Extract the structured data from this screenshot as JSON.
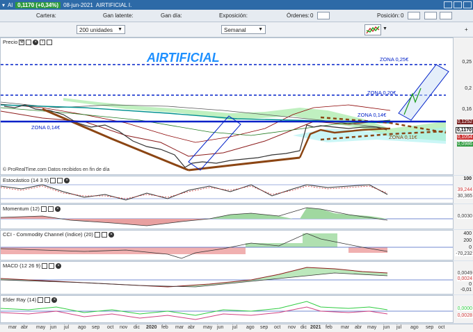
{
  "titlebar": {
    "market": "Al",
    "price": "0,1170 (+0,34%)",
    "date": "08-jun-2021",
    "name": "AIRTIFICIAL I."
  },
  "infobar": {
    "cartera": "Cartera:",
    "ganancia_latente": "Gan latente:",
    "ganancia_dia": "Gan día:",
    "exposicion": "Exposición:",
    "ordenes": "Órdenes:",
    "ordenes_val": "0",
    "posicion": "Posición:",
    "posicion_val": "0"
  },
  "toolbar": {
    "units": "200 unidades",
    "period": "Semanal"
  },
  "price_panel": {
    "title": "Precio",
    "footer": "© ProRealTime.com Datos recibidos en fin de día",
    "watermark": "AIRTIFICIAL",
    "annotations": [
      "ZONA 0,25€",
      "ZONA 0,20€",
      "ZONA 0,14€",
      "ZONA 0,14€",
      "ZONA 0,11€"
    ],
    "yticks": [
      "0,25",
      "0,2",
      "0,16"
    ],
    "boxes": [
      "0,1252",
      "0,1170",
      "0,1054",
      "0,0986"
    ]
  },
  "panels": [
    {
      "title": "Estocástico (14 3 5)",
      "ticks": [
        "100"
      ],
      "boxes": [
        "39,244",
        "30,365"
      ]
    },
    {
      "title": "Momentum (12)",
      "ticks": [],
      "boxes": [
        "0,0030"
      ]
    },
    {
      "title": "CCI - Commodity Channel (índice) (20)",
      "ticks": [
        "400",
        "200",
        "0"
      ],
      "boxes": [
        "-70,232"
      ]
    },
    {
      "title": "MACD (12 26 9)",
      "ticks": [
        "0",
        "-0,01"
      ],
      "boxes": [
        "0,0049",
        "0,0024"
      ]
    },
    {
      "title": "Elder Ray (14)",
      "ticks": [],
      "boxes": [
        "0,0000",
        "0,0028"
      ]
    }
  ],
  "xaxis": [
    "mar",
    "abr",
    "may",
    "jun",
    "jul",
    "ago",
    "sep",
    "oct",
    "nov",
    "dic",
    "2020",
    "feb",
    "mar",
    "abr",
    "may",
    "jun",
    "jul",
    "ago",
    "sep",
    "oct",
    "nov",
    "dic",
    "2021",
    "feb",
    "mar",
    "abr",
    "may",
    "jun",
    "jul",
    "ago",
    "sep",
    "oct"
  ],
  "colors": {
    "accent": "#2d6aa7",
    "zone_line": "#0020c8",
    "bull": "#7fd17f",
    "bear": "#d06060"
  }
}
